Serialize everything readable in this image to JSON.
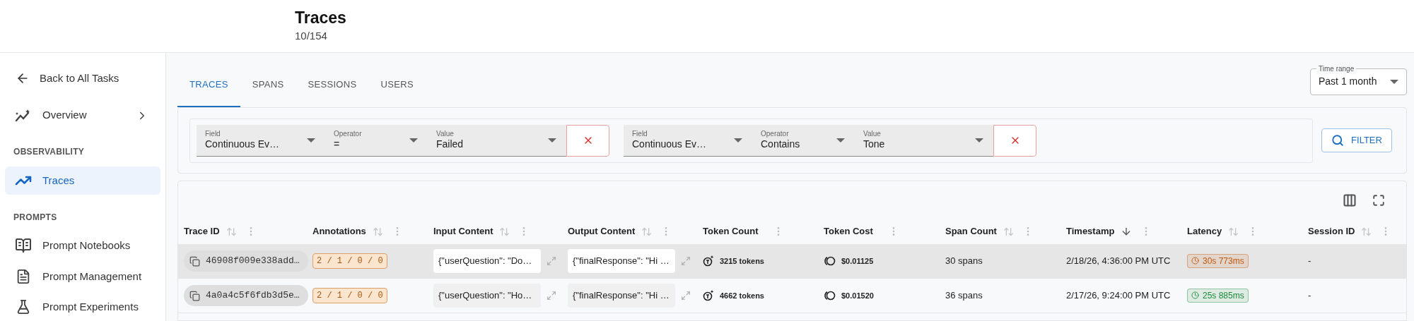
{
  "header": {
    "title": "Traces",
    "count": "10/154"
  },
  "sidebar": [
    {
      "kind": "back",
      "label": "Back to All Tasks"
    },
    {
      "kind": "item",
      "label": "Overview",
      "has_submenu": true,
      "selected": false
    },
    {
      "kind": "heading",
      "label": "OBSERVABILITY"
    },
    {
      "kind": "item",
      "label": "Traces",
      "has_submenu": false,
      "selected": true
    },
    {
      "kind": "heading",
      "label": "PROMPTS"
    },
    {
      "kind": "item",
      "label": "Prompt Notebooks",
      "has_submenu": false,
      "selected": false
    },
    {
      "kind": "item",
      "label": "Prompt Management",
      "has_submenu": false,
      "selected": false
    },
    {
      "kind": "item",
      "label": "Prompt Experiments",
      "has_submenu": false,
      "selected": false
    }
  ],
  "tabs": [
    {
      "label": "TRACES",
      "selected": true
    },
    {
      "label": "SPANS",
      "selected": false
    },
    {
      "label": "SESSIONS",
      "selected": false
    },
    {
      "label": "USERS",
      "selected": false
    }
  ],
  "time_range": {
    "label": "Time range",
    "value": "Past 1 month"
  },
  "filters": [
    {
      "field_label": "Field",
      "field": "Continuous Ev…",
      "operator_label": "Operator",
      "operator": "=",
      "value_label": "Value",
      "value": "Failed"
    },
    {
      "field_label": "Field",
      "field": "Continuous Ev…",
      "operator_label": "Operator",
      "operator": "Contains",
      "value_label": "Value",
      "value": "Tone"
    }
  ],
  "filter_button": "FILTER",
  "table": {
    "columns": [
      {
        "label": "Trace ID",
        "kind": "sortable"
      },
      {
        "label": "Annotations",
        "kind": "sortable"
      },
      {
        "label": "Input Content",
        "kind": "sortable"
      },
      {
        "label": "Output Content",
        "kind": "sortable"
      },
      {
        "label": "Token Count",
        "kind": "plain"
      },
      {
        "label": "Token Cost",
        "kind": "plain"
      },
      {
        "label": "Span Count",
        "kind": "sortable"
      },
      {
        "label": "Timestamp",
        "kind": "sorted"
      },
      {
        "label": "Latency",
        "kind": "sortable"
      },
      {
        "label": "Session ID",
        "kind": "sortable"
      }
    ],
    "rows": [
      {
        "selected": true,
        "trace_id": "46908f009e338add…",
        "annotations": "2 / 1 / 0 / 0",
        "input": "{\"userQuestion\": \"Do…",
        "output": "{\"finalResponse\": \"Hi …",
        "token_count": "3215 tokens",
        "token_cost": "$0.01125",
        "span_count": "30 spans",
        "timestamp": "2/18/26, 4:36:00 PM UTC",
        "latency": {
          "text": "30s 773ms",
          "color": "#c2570c"
        },
        "session_id": "-"
      },
      {
        "selected": false,
        "trace_id": "4a0a4c5f6fdb3d5e…",
        "annotations": "2 / 1 / 0 / 0",
        "input": "{\"userQuestion\": \"Ho…",
        "output": "{\"finalResponse\": \"Hi …",
        "token_count": "4662 tokens",
        "token_cost": "$0.01520",
        "span_count": "36 spans",
        "timestamp": "2/17/26, 9:24:00 PM UTC",
        "latency": {
          "text": "25s 885ms",
          "color": "#1e8a3c"
        },
        "session_id": "-"
      }
    ]
  }
}
